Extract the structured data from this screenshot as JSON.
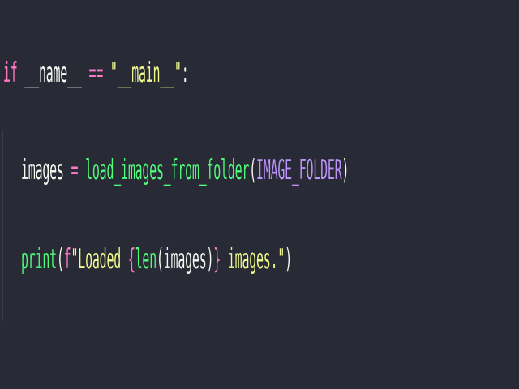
{
  "editor": {
    "theme_background": "#282a36",
    "colors": {
      "keyword": "#ff79c6",
      "string": "#f1fa8c",
      "function": "#50fa7b",
      "constant": "#bd93f9",
      "text": "#f8f8f2"
    },
    "lines": [
      {
        "tokens": [
          "if",
          " ",
          "__name__",
          " ",
          "==",
          " ",
          "\"__main__\"",
          ":"
        ]
      },
      {
        "tokens": [
          "images",
          " ",
          "=",
          " ",
          "load_images_from_folder",
          "(",
          "IMAGE_FOLDER",
          ")"
        ]
      },
      {
        "tokens": [
          "print",
          "(",
          "f",
          "\"Loaded ",
          "{",
          "len",
          "(",
          "images",
          ")",
          "}",
          " images.\"",
          ")"
        ]
      }
    ]
  }
}
